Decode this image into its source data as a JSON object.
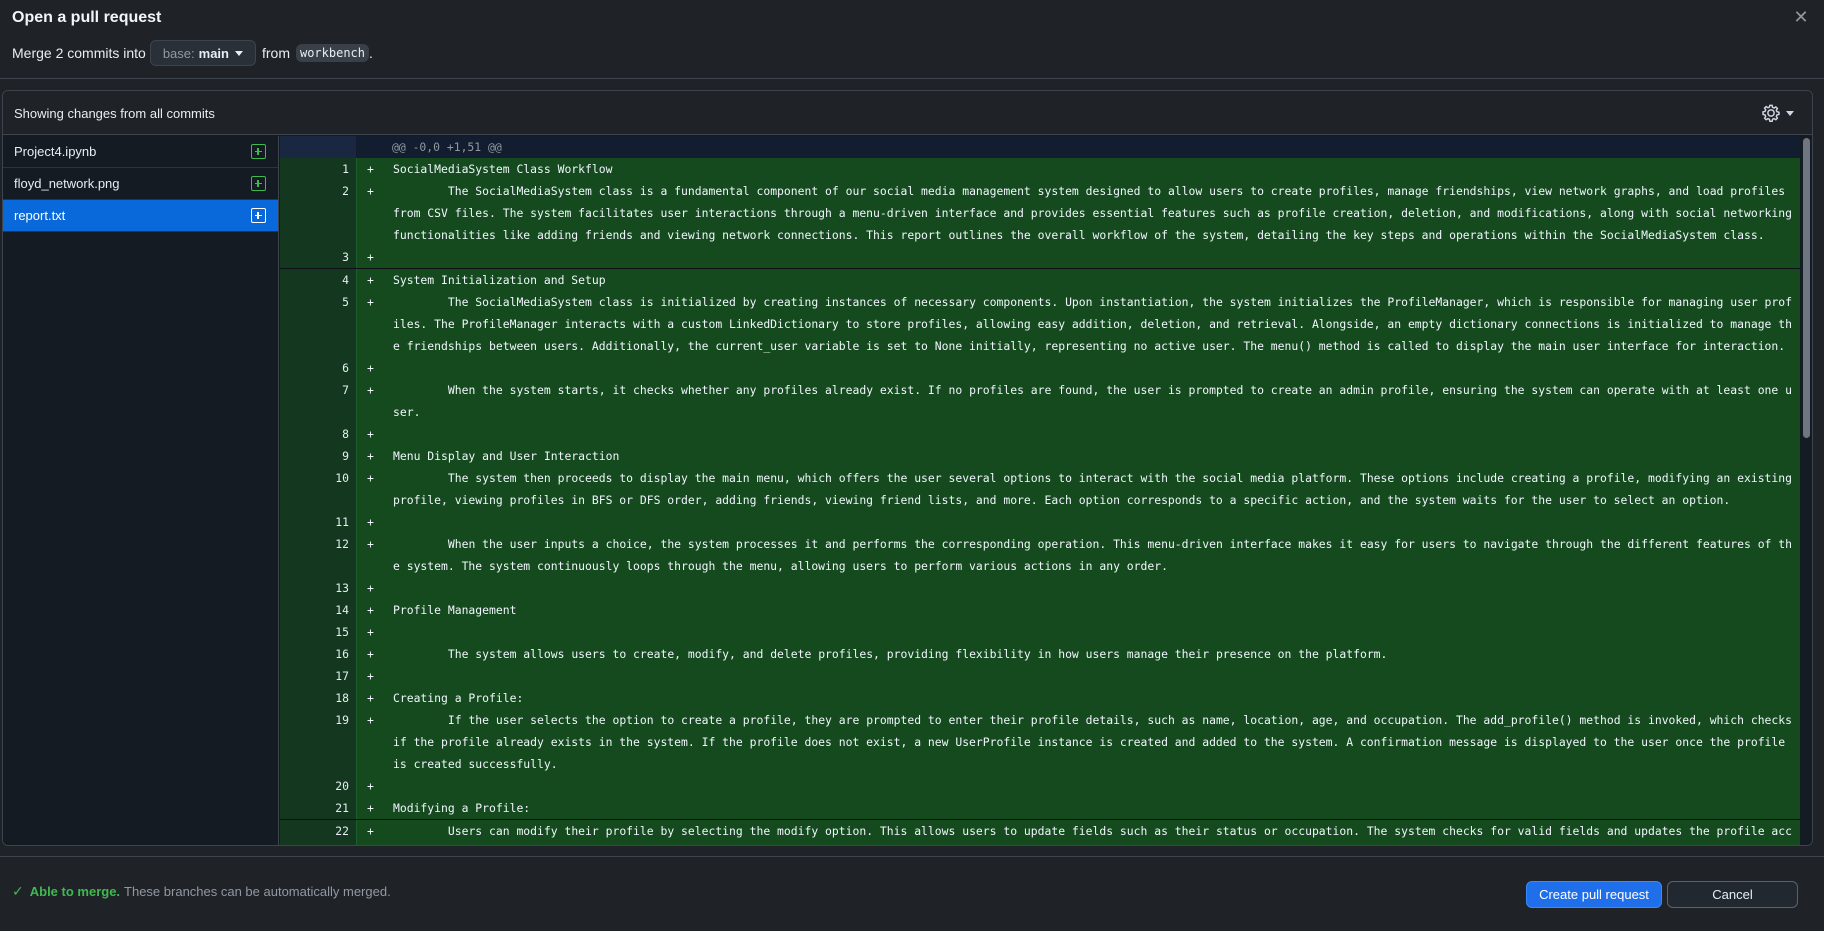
{
  "header": {
    "title": "Open a pull request",
    "merge_prefix": "Merge 2 commits into",
    "base_label": "base:",
    "base_branch": "main",
    "from_label": "from",
    "compare_branch": "workbench",
    "suffix": "."
  },
  "panel": {
    "heading": "Showing changes from all commits"
  },
  "files": [
    {
      "name": "Project4.ipynb",
      "active": false
    },
    {
      "name": "floyd_network.png",
      "active": false
    },
    {
      "name": "report.txt",
      "active": true
    }
  ],
  "diff": {
    "hunk_header": "@@ -0,0 +1,51 @@",
    "lines": [
      {
        "n": "1",
        "text": "SocialMediaSystem Class Workflow"
      },
      {
        "n": "2",
        "text": "        The SocialMediaSystem class is a fundamental component of our social media management system designed to allow users to create profiles, manage friendships, view network graphs, and load profiles from CSV files. The system facilitates user interactions through a menu-driven interface and provides essential features such as profile creation, deletion, and modifications, along with social networking functionalities like adding friends and viewing network connections. This report outlines the overall workflow of the system, detailing the key steps and operations within the SocialMediaSystem class."
      },
      {
        "n": "3",
        "text": ""
      },
      {
        "n": "4",
        "text": "System Initialization and Setup"
      },
      {
        "n": "5",
        "text": "        The SocialMediaSystem class is initialized by creating instances of necessary components. Upon instantiation, the system initializes the ProfileManager, which is responsible for managing user profiles. The ProfileManager interacts with a custom LinkedDictionary to store profiles, allowing easy addition, deletion, and retrieval. Alongside, an empty dictionary connections is initialized to manage the friendships between users. Additionally, the current_user variable is set to None initially, representing no active user. The menu() method is called to display the main user interface for interaction."
      },
      {
        "n": "6",
        "text": ""
      },
      {
        "n": "7",
        "text": "        When the system starts, it checks whether any profiles already exist. If no profiles are found, the user is prompted to create an admin profile, ensuring the system can operate with at least one user."
      },
      {
        "n": "8",
        "text": ""
      },
      {
        "n": "9",
        "text": "Menu Display and User Interaction"
      },
      {
        "n": "10",
        "text": "        The system then proceeds to display the main menu, which offers the user several options to interact with the social media platform. These options include creating a profile, modifying an existing profile, viewing profiles in BFS or DFS order, adding friends, viewing friend lists, and more. Each option corresponds to a specific action, and the system waits for the user to select an option."
      },
      {
        "n": "11",
        "text": ""
      },
      {
        "n": "12",
        "text": "        When the user inputs a choice, the system processes it and performs the corresponding operation. This menu-driven interface makes it easy for users to navigate through the different features of the system. The system continuously loops through the menu, allowing users to perform various actions in any order."
      },
      {
        "n": "13",
        "text": ""
      },
      {
        "n": "14",
        "text": "Profile Management"
      },
      {
        "n": "15",
        "text": ""
      },
      {
        "n": "16",
        "text": "        The system allows users to create, modify, and delete profiles, providing flexibility in how users manage their presence on the platform."
      },
      {
        "n": "17",
        "text": ""
      },
      {
        "n": "18",
        "text": "Creating a Profile:"
      },
      {
        "n": "19",
        "text": "        If the user selects the option to create a profile, they are prompted to enter their profile details, such as name, location, age, and occupation. The add_profile() method is invoked, which checks if the profile already exists in the system. If the profile does not exist, a new UserProfile instance is created and added to the system. A confirmation message is displayed to the user once the profile is created successfully."
      },
      {
        "n": "20",
        "text": ""
      },
      {
        "n": "21",
        "text": "Modifying a Profile:"
      },
      {
        "n": "22",
        "text": "        Users can modify their profile by selecting the modify option. This allows users to update fields such as their status or occupation. The system checks for valid fields and updates the profile accordingly."
      }
    ]
  },
  "footer": {
    "status_strong": "Able to merge.",
    "status_text": "These branches can be automatically merged.",
    "create_label": "Create pull request",
    "cancel_label": "Cancel"
  },
  "colors": {
    "accent": "#1f6feb",
    "success": "#3fb950",
    "addition_bg": "#154a1f"
  }
}
